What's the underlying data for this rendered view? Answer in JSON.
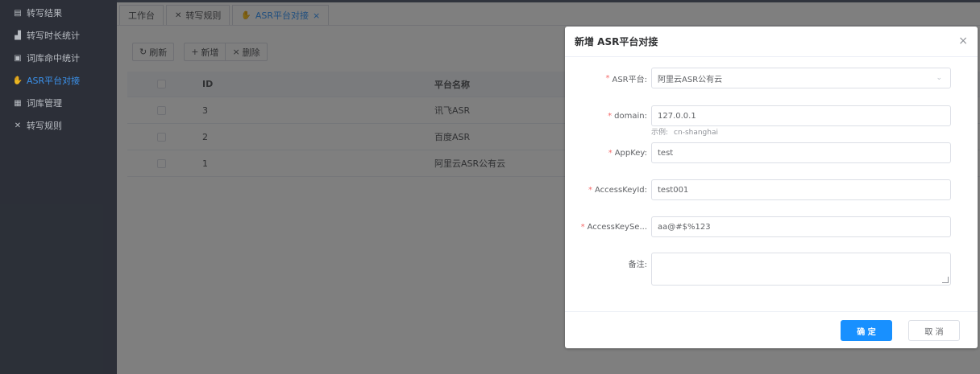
{
  "sidebar": {
    "items": [
      {
        "label": "转写结果",
        "icon": "document-edit-icon",
        "glyph": "▤"
      },
      {
        "label": "转写时长统计",
        "icon": "bar-chart-icon",
        "glyph": "▟"
      },
      {
        "label": "词库命中统计",
        "icon": "report-icon",
        "glyph": "▣"
      },
      {
        "label": "ASR平台对接",
        "icon": "thumb-up-icon",
        "glyph": "✋",
        "active": true
      },
      {
        "label": "词库管理",
        "icon": "grid-icon",
        "glyph": "▦"
      },
      {
        "label": "转写规则",
        "icon": "tools-icon",
        "glyph": "✕"
      }
    ]
  },
  "tabs": [
    {
      "label": "工作台"
    },
    {
      "label": "转写规则",
      "icon": "tools-icon",
      "glyph": "✕"
    },
    {
      "label": "ASR平台对接",
      "icon": "thumb-up-icon",
      "glyph": "✋",
      "active": true,
      "close": "×"
    }
  ],
  "toolbar": {
    "refresh_label": "刷新",
    "refresh_glyph": "↻",
    "add_label": "新增",
    "add_glyph": "+",
    "delete_label": "删除",
    "delete_glyph": "×"
  },
  "table": {
    "headers": {
      "id": "ID",
      "name": "平台名称"
    },
    "rows": [
      {
        "id": "3",
        "name": "讯飞ASR"
      },
      {
        "id": "2",
        "name": "百度ASR"
      },
      {
        "id": "1",
        "name": "阿里云ASR公有云"
      }
    ]
  },
  "dialog": {
    "title": "新增 ASR平台对接",
    "close": "×",
    "required_mark": "*",
    "fields": {
      "platform": {
        "label": "ASR平台:",
        "value": "阿里云ASR公有云",
        "chevron": "⌄"
      },
      "domain": {
        "label": "domain:",
        "value": "127.0.0.1",
        "hint_label": "示例:",
        "hint_value": "cn-shanghai"
      },
      "appkey": {
        "label": "AppKey:",
        "value": "test"
      },
      "accesskeyid": {
        "label": "AccessKeyId:",
        "value": "test001"
      },
      "accesskeysecret": {
        "label": "AccessKeySe...",
        "value": "aa@#$%123"
      },
      "remark": {
        "label": "备注:",
        "value": ""
      }
    },
    "ok_label": "确 定",
    "cancel_label": "取 消"
  },
  "colors": {
    "sidebar_bg": "#30343d",
    "accent": "#409eff",
    "primary_button": "#1890ff",
    "required": "#f56c6c"
  }
}
